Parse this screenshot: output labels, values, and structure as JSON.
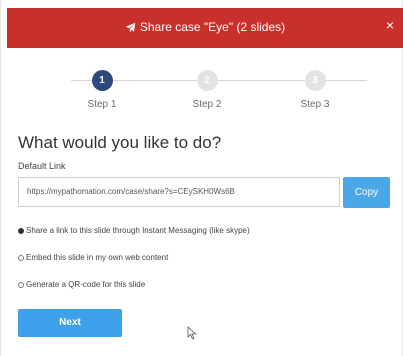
{
  "dialog": {
    "title": "Share case \"Eye\" (2 slides)",
    "close_label": "×",
    "header_color": "#c9302c",
    "title_icon": "send-icon"
  },
  "stepper": {
    "steps": [
      {
        "number": "1",
        "label": "Step 1",
        "active": true
      },
      {
        "number": "2",
        "label": "Step 2",
        "active": false
      },
      {
        "number": "3",
        "label": "Step 3",
        "active": false
      }
    ]
  },
  "main": {
    "question": "What would you like to do?",
    "default_link_label": "Default Link",
    "link_value": "https://mypathomation.com/case/share?s=CEySKH0Ws6B",
    "copy_label": "Copy",
    "options": [
      {
        "label": "Share a link to this slide through Instant Messaging (like skype)",
        "checked": true
      },
      {
        "label": "Embed this slide in my own web content",
        "checked": false
      },
      {
        "label": "Generate a QR-code for this slide",
        "checked": false
      }
    ],
    "next_label": "Next"
  },
  "colors": {
    "accent": "#3ea0ea",
    "step_active": "#2e4a7d"
  }
}
